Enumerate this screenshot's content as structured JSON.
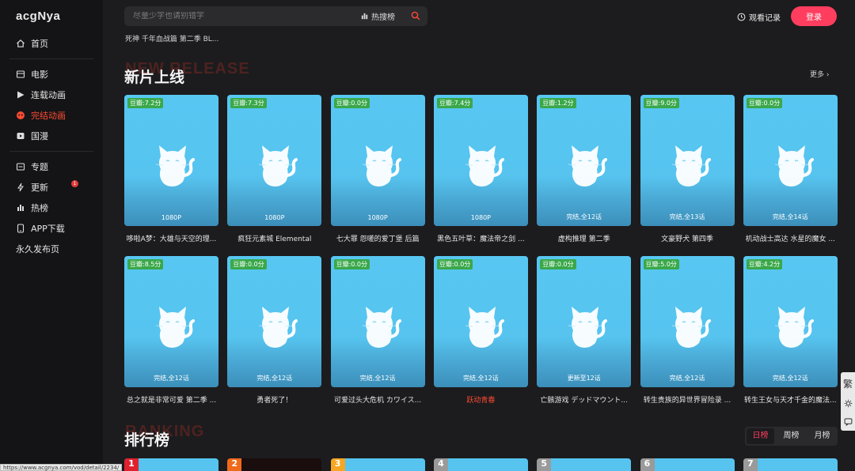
{
  "brand": {
    "logo": "acgNya"
  },
  "sidebar": {
    "group1": [
      {
        "label": "首页",
        "icon": "home-icon"
      }
    ],
    "group2": [
      {
        "label": "电影",
        "icon": "film-icon"
      },
      {
        "label": "连载动画",
        "icon": "play-icon"
      },
      {
        "label": "完结动画",
        "icon": "anime-icon",
        "active": true
      },
      {
        "label": "国漫",
        "icon": "tv-icon"
      }
    ],
    "group3": [
      {
        "label": "专题",
        "icon": "topic-icon"
      },
      {
        "label": "更新",
        "icon": "lightning-icon",
        "badge": "1"
      },
      {
        "label": "热榜",
        "icon": "chart-icon"
      },
      {
        "label": "APP下载",
        "icon": "phone-icon"
      },
      {
        "label": "永久发布页"
      }
    ]
  },
  "header": {
    "search_placeholder": "尽量少字也请别错字",
    "hot_label": "热搜榜",
    "recent_search": "死神 千年血战篇 第二季 BL...",
    "history_label": "观看记录",
    "login_label": "登录"
  },
  "sections": {
    "new": {
      "title": "新片上线",
      "ghost": "NEW RELEASE",
      "more": "更多 ›"
    },
    "rank": {
      "title": "排行榜",
      "ghost": "RANKING",
      "tabs": [
        "日榜",
        "周榜",
        "月榜"
      ],
      "active_tab": 0
    }
  },
  "cards_row1": [
    {
      "score": "豆瓣:7.2分",
      "status": "1080P",
      "title": "哆啦A梦：大雄与天空的理..."
    },
    {
      "score": "豆瓣:7.3分",
      "status": "1080P",
      "title": "疯狂元素城 Elemental"
    },
    {
      "score": "豆瓣:0.0分",
      "status": "1080P",
      "title": "七大罪 怨嗟的爱丁堡 后篇"
    },
    {
      "score": "豆瓣:7.4分",
      "status": "1080P",
      "title": "黑色五叶草：魔法帝之剑 ..."
    },
    {
      "score": "豆瓣:1.2分",
      "status": "完结,全12话",
      "title": "虚构推理 第二季"
    },
    {
      "score": "豆瓣:9.0分",
      "status": "完结,全13话",
      "title": "文豪野犬 第四季"
    },
    {
      "score": "豆瓣:0.0分",
      "status": "完结,全14话",
      "title": "机动战士高达 水星的魔女 ..."
    }
  ],
  "cards_row2": [
    {
      "score": "豆瓣:8.5分",
      "status": "完结,全12话",
      "title": "总之就是非常可爱 第二季 ..."
    },
    {
      "score": "豆瓣:0.0分",
      "status": "完结,全12话",
      "title": "勇者死了！"
    },
    {
      "score": "豆瓣:0.0分",
      "status": "完结,全12话",
      "title": "可爱过头大危机 カワイス..."
    },
    {
      "score": "豆瓣:0.0分",
      "status": "完结,全12话",
      "title": "跃动青春",
      "red": true
    },
    {
      "score": "豆瓣:0.0分",
      "status": "更新至12话",
      "title": "亡骸游戏 デッドマウント..."
    },
    {
      "score": "豆瓣:5.0分",
      "status": "完结,全12话",
      "title": "转生贵族的异世界冒险录 ..."
    },
    {
      "score": "豆瓣:4.2分",
      "status": "完结,全12话",
      "title": "转生王女与天才千金的魔法..."
    }
  ],
  "rank_numbers": [
    "1",
    "2",
    "3",
    "4",
    "5",
    "6",
    "7"
  ],
  "rank_colors": [
    "#e0222f",
    "#f06a1c",
    "#f5a623",
    "#9a9a9a",
    "#9a9a9a",
    "#9a9a9a",
    "#9a9a9a"
  ],
  "float_bar": {
    "label": "繁"
  },
  "status_url": "https://www.acgnya.com/vod/detail/2234/"
}
